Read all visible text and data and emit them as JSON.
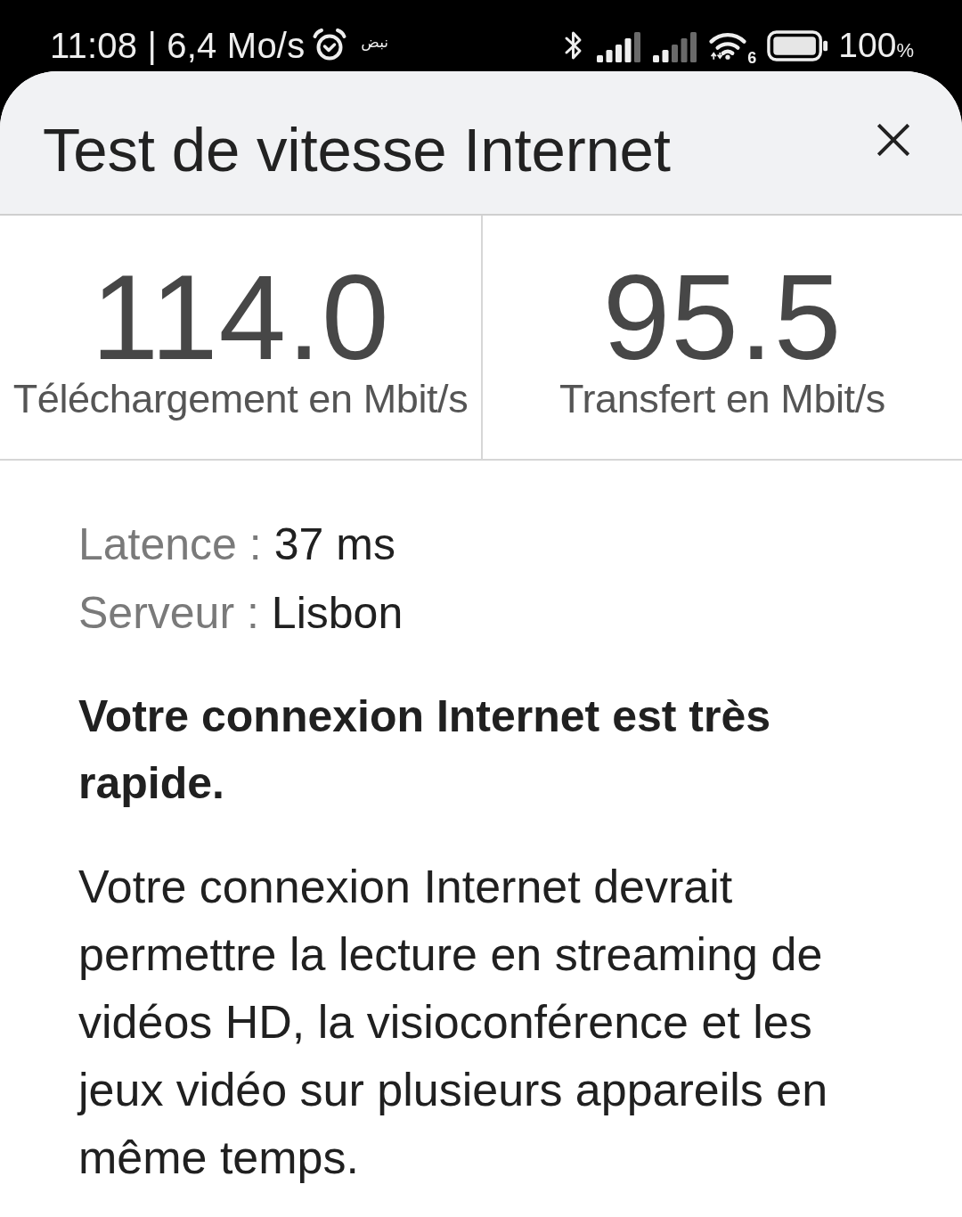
{
  "status_bar": {
    "time_and_speed": "11:08 | 6,4 Mo/s",
    "notification_text": "نبض",
    "wifi_generation": "6",
    "battery": {
      "value": "100",
      "unit": "%"
    }
  },
  "header": {
    "title": "Test de vitesse Internet"
  },
  "results": [
    {
      "value": "114.0",
      "label": "Téléchargement en Mbit/s"
    },
    {
      "value": "95.5",
      "label": "Transfert en Mbit/s"
    }
  ],
  "details": [
    {
      "label": "Latence :",
      "value": "37 ms"
    },
    {
      "label": "Serveur :",
      "value": "Lisbon"
    }
  ],
  "summary": "Votre connexion Internet est très rapide.",
  "description": "Votre connexion Internet devrait permettre la lecture en streaming de vidéos HD, la visioconférence et les jeux vidéo sur plusieurs appareils en même temps."
}
